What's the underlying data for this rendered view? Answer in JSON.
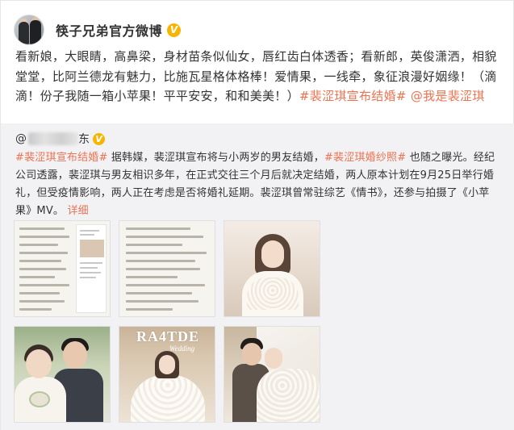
{
  "post": {
    "author": "筷子兄弟官方微博",
    "verified_badge": "V",
    "text_plain": "看新娘，大眼睛，高鼻梁，身材苗条似仙女，唇红齿白体透香；看新郎，英俊潇洒，相貌堂堂，比阿兰德龙有魅力，比施瓦星格体格棒！爱情果，一线牵，象征浪漫好姻缘！（滴滴！份子我随一箱小苹果！平平安安，和和美美！）",
    "hashtag": "#裴涩琪宣布结婚#",
    "mention": "@我是裴涩琪"
  },
  "retweet": {
    "author_suffix": "东",
    "verified_badge": "V",
    "hashtag1": "#裴涩琪宣布结婚#",
    "text1": " 据韩媒，裴涩琪宣布将与小两岁的男友结婚，",
    "hashtag2": "#裴涩琪婚纱照#",
    "text2": " 也随之曝光。经纪公司透露，裴涩琪与男友相识多年，在正式交往三个月后就决定结婚，两人原本计划在9月25日举行婚礼，但受疫情影响，两人正在考虑是否将婚礼延期。裴涩琪曾常驻综艺《情书》，还参与拍摄了《小苹果》MV。",
    "more_link": "详细",
    "images": [
      {
        "name": "screenshot-text-1"
      },
      {
        "name": "screenshot-text-2"
      },
      {
        "name": "bride-portrait"
      },
      {
        "name": "couple-garden"
      },
      {
        "name": "bride-magazine"
      },
      {
        "name": "couple-veil"
      }
    ],
    "magazine_title": "RA4TDE",
    "magazine_subtitle": "Wedding"
  },
  "colors": {
    "link": "#eb7350",
    "badge": "#f7b500",
    "retweet_bg": "#f2f2f5",
    "text": "#333333"
  }
}
